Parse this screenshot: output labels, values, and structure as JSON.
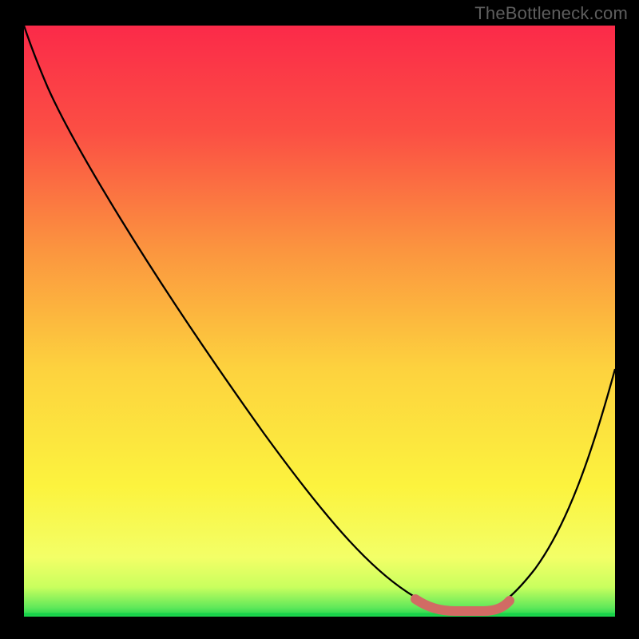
{
  "watermark": "TheBottleneck.com",
  "colors": {
    "gradient_top": "#fb2a49",
    "gradient_mid1": "#fb7a3f",
    "gradient_mid2": "#fde43e",
    "gradient_low": "#f7ff6e",
    "gradient_green": "#18d24a",
    "curve": "#000000",
    "band": "#d16b64",
    "frame": "#000000"
  },
  "chart_data": {
    "type": "line",
    "title": "",
    "xlabel": "",
    "ylabel": "",
    "xlim": [
      0,
      100
    ],
    "ylim": [
      0,
      100
    ],
    "series": [
      {
        "name": "bottleneck-curve",
        "x": [
          0,
          3,
          10,
          20,
          30,
          40,
          50,
          58,
          63,
          67,
          71,
          75,
          78,
          82,
          88,
          94,
          100
        ],
        "y": [
          100,
          96,
          88,
          75,
          61,
          47,
          33,
          21,
          13,
          7,
          3,
          1,
          1,
          3,
          12,
          26,
          42
        ]
      }
    ],
    "optimal_range": {
      "x_start": 67,
      "x_end": 81,
      "y": 1
    },
    "annotations": []
  }
}
